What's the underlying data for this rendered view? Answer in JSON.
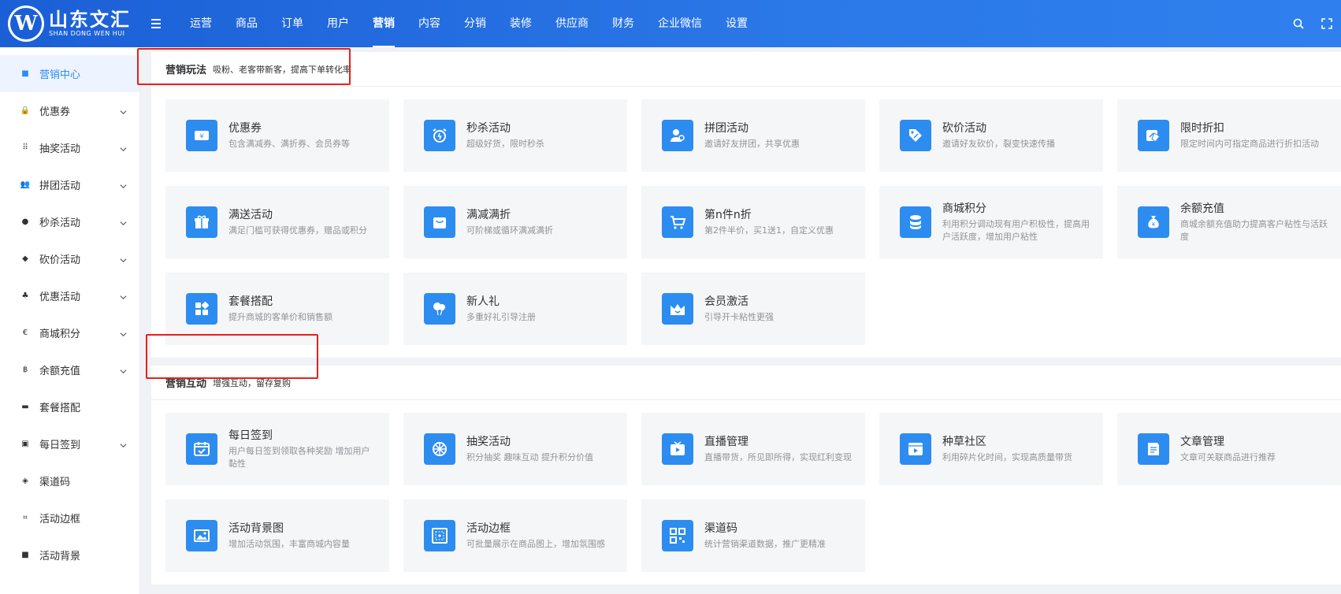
{
  "header": {
    "logo_mark": "W",
    "logo_cn": "山东文汇",
    "logo_en": "SHAN DONG WEN HUI",
    "nav": [
      {
        "label": "运营",
        "active": false
      },
      {
        "label": "商品",
        "active": false
      },
      {
        "label": "订单",
        "active": false
      },
      {
        "label": "用户",
        "active": false
      },
      {
        "label": "营销",
        "active": true
      },
      {
        "label": "内容",
        "active": false
      },
      {
        "label": "分销",
        "active": false
      },
      {
        "label": "装修",
        "active": false
      },
      {
        "label": "供应商",
        "active": false
      },
      {
        "label": "财务",
        "active": false
      },
      {
        "label": "企业微信",
        "active": false
      },
      {
        "label": "设置",
        "active": false
      }
    ]
  },
  "sidebar": {
    "items": [
      {
        "label": "营销中心",
        "icon": "square-icon",
        "glyph": "■",
        "active": true,
        "expandable": false
      },
      {
        "label": "优惠券",
        "icon": "lock-icon",
        "glyph": "🔒",
        "active": false,
        "expandable": true
      },
      {
        "label": "抽奖活动",
        "icon": "grid-icon",
        "glyph": "⠿",
        "active": false,
        "expandable": true
      },
      {
        "label": "拼团活动",
        "icon": "group-icon",
        "glyph": "👥",
        "active": false,
        "expandable": true
      },
      {
        "label": "秒杀活动",
        "icon": "clock-icon",
        "glyph": "●",
        "active": false,
        "expandable": true
      },
      {
        "label": "砍价活动",
        "icon": "tag-icon",
        "glyph": "◆",
        "active": false,
        "expandable": true
      },
      {
        "label": "优惠活动",
        "icon": "people-icon",
        "glyph": "♣",
        "active": false,
        "expandable": true
      },
      {
        "label": "商城积分",
        "icon": "euro-icon",
        "glyph": "€",
        "active": false,
        "expandable": true
      },
      {
        "label": "余额充值",
        "icon": "bitcoin-icon",
        "glyph": "฿",
        "active": false,
        "expandable": true
      },
      {
        "label": "套餐搭配",
        "icon": "cup-icon",
        "glyph": "▬",
        "active": false,
        "expandable": false
      },
      {
        "label": "每日签到",
        "icon": "calendar-icon",
        "glyph": "▣",
        "active": false,
        "expandable": true
      },
      {
        "label": "渠道码",
        "icon": "cube-icon",
        "glyph": "◈",
        "active": false,
        "expandable": false
      },
      {
        "label": "活动边框",
        "icon": "crop-icon",
        "glyph": "⌗",
        "active": false,
        "expandable": false
      },
      {
        "label": "活动背景",
        "icon": "square-icon",
        "glyph": "■",
        "active": false,
        "expandable": false
      }
    ]
  },
  "sections": [
    {
      "title": "营销玩法",
      "subtitle": "吸粉、老客带新客，提高下单转化率",
      "cards": [
        {
          "title": "优惠券",
          "desc": "包含满减券、满折券、会员券等",
          "icon": "coupon-icon"
        },
        {
          "title": "秒杀活动",
          "desc": "超级好货，限时秒杀",
          "icon": "alarm-clock-icon"
        },
        {
          "title": "拼团活动",
          "desc": "邀请好友拼团，共享优惠",
          "icon": "users-icon"
        },
        {
          "title": "砍价活动",
          "desc": "邀请好友砍价，裂变快速传播",
          "icon": "price-tag-icon"
        },
        {
          "title": "限时折扣",
          "desc": "限定时间内可指定商品进行折扣活动",
          "icon": "discount-tag-icon"
        },
        {
          "title": "满送活动",
          "desc": "满足门槛可获得优惠券，赠品或积分",
          "icon": "gift-icon"
        },
        {
          "title": "满减满折",
          "desc": "可阶梯或循环满减满折",
          "icon": "bag-icon"
        },
        {
          "title": "第n件n折",
          "desc": "第2件半价，买1送1，自定义优惠",
          "icon": "cart-icon"
        },
        {
          "title": "商城积分",
          "desc": "利用积分调动现有用户积极性，提高用户活跃度，增加用户粘性",
          "icon": "database-icon"
        },
        {
          "title": "余额充值",
          "desc": "商城余额充值助力提高客户粘性与活跃度",
          "icon": "money-bag-icon"
        },
        {
          "title": "套餐搭配",
          "desc": "提升商城的客单价和销售额",
          "icon": "apps-icon"
        },
        {
          "title": "新人礼",
          "desc": "多重好礼引导注册",
          "icon": "balloon-icon"
        },
        {
          "title": "会员激活",
          "desc": "引导开卡粘性更强",
          "icon": "crown-icon"
        }
      ]
    },
    {
      "title": "营销互动",
      "subtitle": "增强互动，留存复购",
      "cards": [
        {
          "title": "每日签到",
          "desc": "用户每日签到领取各种奖励 增加用户黏性",
          "icon": "calendar-check-icon"
        },
        {
          "title": "抽奖活动",
          "desc": "积分抽奖 趣味互动 提升积分价值",
          "icon": "wheel-icon"
        },
        {
          "title": "直播管理",
          "desc": "直播带货，所见即所得，实现红利变现",
          "icon": "tv-play-icon"
        },
        {
          "title": "种草社区",
          "desc": "利用碎片化时间，实现高质量带货",
          "icon": "video-icon"
        },
        {
          "title": "文章管理",
          "desc": "文章可关联商品进行推荐",
          "icon": "document-icon"
        },
        {
          "title": "活动背景图",
          "desc": "增加活动氛围，丰富商城内容量",
          "icon": "image-icon"
        },
        {
          "title": "活动边框",
          "desc": "可批量展示在商品图上，增加氛围感",
          "icon": "frame-icon"
        },
        {
          "title": "渠道码",
          "desc": "统计营销渠道数据，推广更精准",
          "icon": "qrcode-icon"
        }
      ]
    }
  ],
  "colors": {
    "brand_blue": "#2b78e8",
    "card_icon_bg": "#2d8cf0",
    "highlight_red": "#e8201a",
    "active_sidebar_bg": "#eef4ff"
  }
}
